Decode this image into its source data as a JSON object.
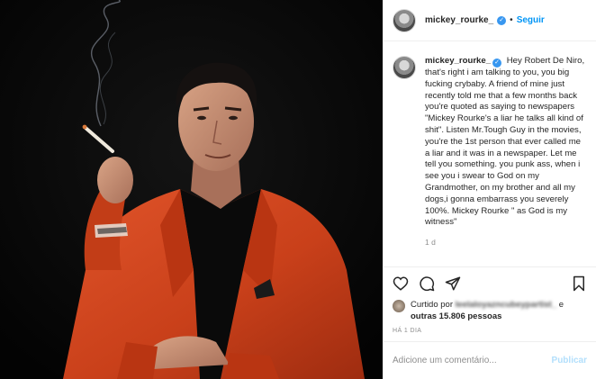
{
  "post": {
    "author": {
      "username": "mickey_rourke_",
      "verified_icon": "verified-badge-icon",
      "separator": "•",
      "follow_label": "Seguir"
    },
    "media": {
      "icon": "portrait-photo"
    },
    "caption": {
      "username": "mickey_rourke_",
      "text": "Hey Robert De Niro, that's right i am talking to you, you big fucking crybaby. A friend of mine just recently told me that a few months back you're quoted as saying to newspapers \"Mickey Rourke's a liar he talks all kind of shit\". Listen Mr.Tough Guy in the movies, you're the 1st person that ever called me a liar and it was in a newspaper. Let me tell you something. you punk ass, when i see you i swear to God on my Grandmother, on my brother and all my dogs,i gonna embarrass you severely 100%. Mickey Rourke \" as God is my witness\"",
      "relative_time": "1 d"
    },
    "actions": {
      "like_icon": "heart-icon",
      "comment_icon": "comment-icon",
      "share_icon": "share-icon",
      "save_icon": "bookmark-icon"
    },
    "likes": {
      "prefix": "Curtido por",
      "liker": "leelaloyazncubeypartist_",
      "connector": "e",
      "others": "outras 15.806 pessoas"
    },
    "date_label": "HÁ 1 DIA",
    "comment": {
      "placeholder": "Adicione um comentário...",
      "publish_label": "Publicar"
    },
    "colors": {
      "link": "#0095f6",
      "publish_disabled": "#b2dffc",
      "jacket": "#d6461c",
      "background": "#050505"
    }
  }
}
